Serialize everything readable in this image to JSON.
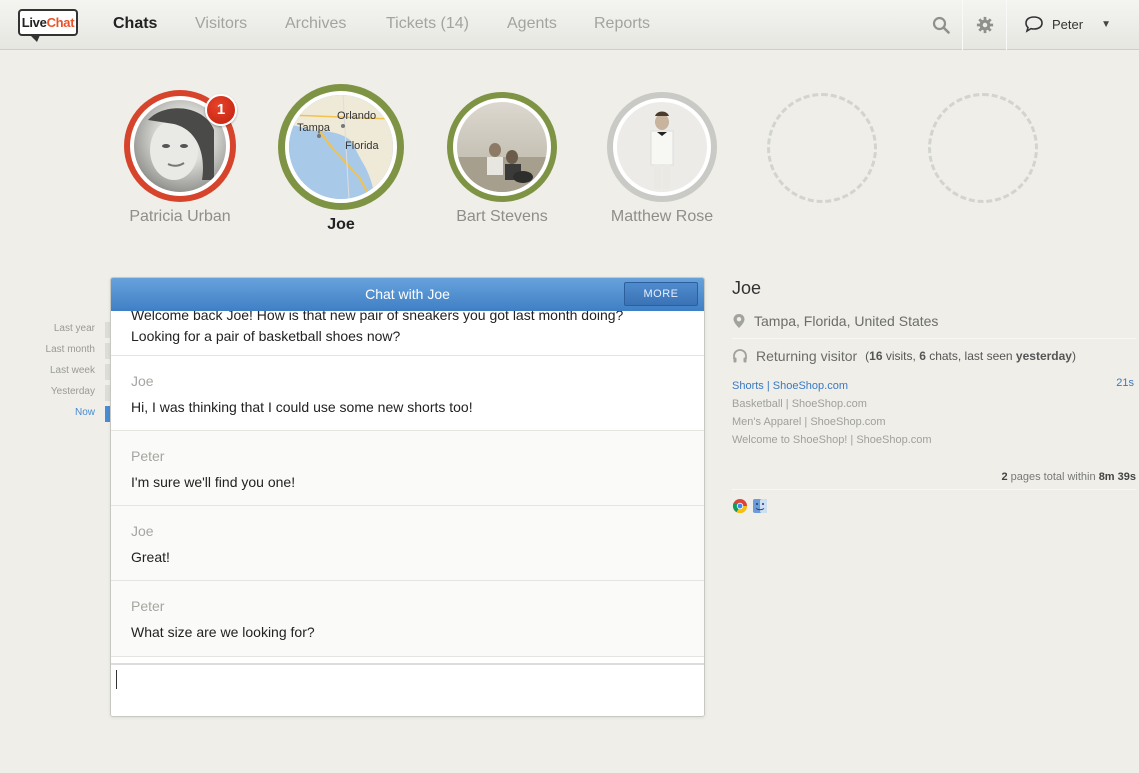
{
  "app": {
    "logo_part1": "Live",
    "logo_part2": "Chat"
  },
  "nav": {
    "items": [
      {
        "label": "Chats",
        "active": true
      },
      {
        "label": "Visitors",
        "active": false
      },
      {
        "label": "Archives",
        "active": false
      },
      {
        "label": "Tickets (14)",
        "active": false
      },
      {
        "label": "Agents",
        "active": false
      },
      {
        "label": "Reports",
        "active": false
      }
    ],
    "search_icon": "search-icon",
    "settings_icon": "gear-icon",
    "user_name": "Peter",
    "user_icon": "speech-bubble-icon"
  },
  "visitors": [
    {
      "name": "Patricia Urban",
      "ring_color": "#d7442c",
      "badge": "1"
    },
    {
      "name": "Joe",
      "ring_color": "#7e9444",
      "map_labels": [
        "Orlando",
        "Tampa",
        "Florida"
      ]
    },
    {
      "name": "Bart Stevens",
      "ring_color": "#7e9444"
    },
    {
      "name": "Matthew Rose",
      "ring_color": "#c9c9c5"
    }
  ],
  "timeline": [
    {
      "label": "Last year",
      "active": false
    },
    {
      "label": "Last month",
      "active": false
    },
    {
      "label": "Last week",
      "active": false
    },
    {
      "label": "Yesterday",
      "active": false
    },
    {
      "label": "Now",
      "active": true
    }
  ],
  "chat": {
    "title": "Chat with Joe",
    "more_label": "MORE",
    "first_message_top": "Welcome back Joe! How is that new pair of sneakers you got last month doing?",
    "first_message_bottom": "Looking for a pair of basketball shoes now?",
    "messages": [
      {
        "author": "Joe",
        "text": "Hi, I was thinking that I could use some new shorts too!"
      },
      {
        "author": "Peter",
        "text": "I'm sure we'll find you one!"
      },
      {
        "author": "Joe",
        "text": "Great!"
      },
      {
        "author": "Peter",
        "text": "What size are we looking for?"
      }
    ],
    "input_value": ""
  },
  "details": {
    "name": "Joe",
    "location": "Tampa, Florida, United States",
    "visitor_type": "Returning visitor",
    "stats": {
      "open": "(",
      "visits": "16",
      "visits_label": " visits, ",
      "chats": "6",
      "chats_label": " chats, last seen ",
      "last_seen": "yesterday",
      "close": ")"
    },
    "pages": [
      {
        "title": "Shorts | ShoeShop.com",
        "time": "21s",
        "current": true
      },
      {
        "title": "Basketball | ShoeShop.com",
        "current": false
      },
      {
        "title": "Men's Apparel | ShoeShop.com",
        "current": false
      },
      {
        "title": "Welcome to ShoeShop! | ShoeShop.com",
        "current": false
      }
    ],
    "summary": {
      "count": "2",
      "text": " pages total within ",
      "duration": "8m 39s"
    },
    "browser_icons": [
      "chrome-icon",
      "mac-finder-icon"
    ]
  }
}
